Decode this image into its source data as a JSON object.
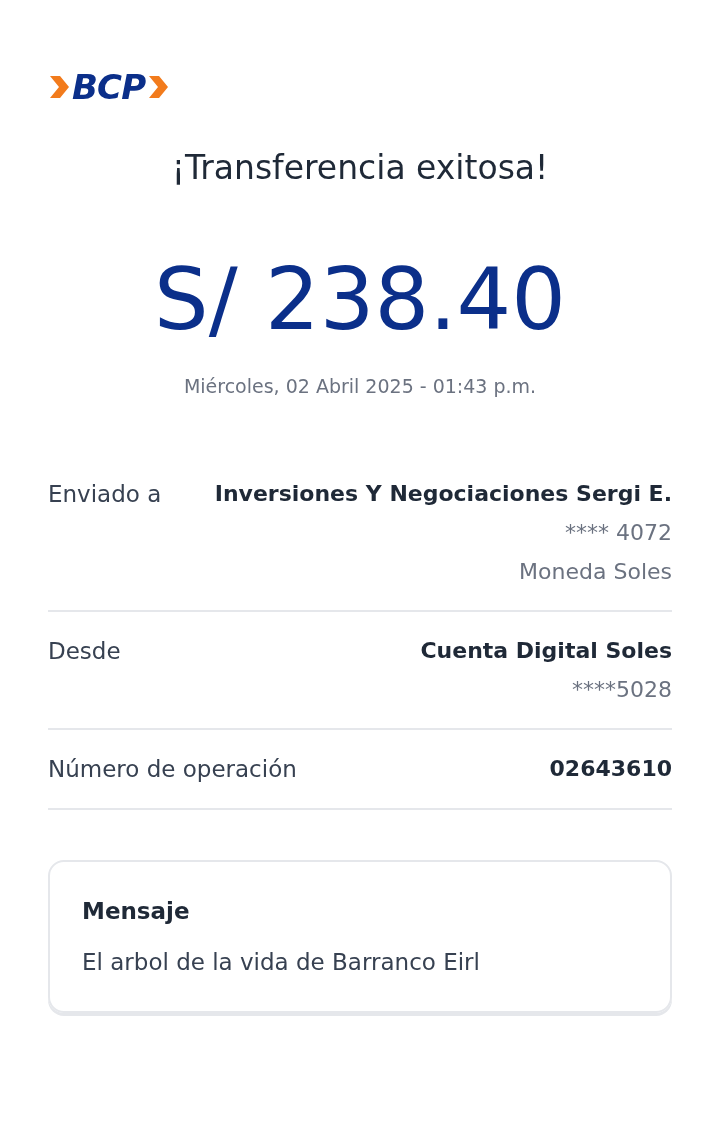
{
  "logo": "BCP",
  "title": "¡Transferencia exitosa!",
  "amount": "S/ 238.40",
  "datetime": "Miércoles, 02 Abril 2025 - 01:43 p.m.",
  "details": [
    {
      "label": "Enviado a",
      "lines": [
        {
          "text": "Inversiones Y Negociaciones Sergi E.",
          "bold": true
        },
        {
          "text": "**** 4072",
          "bold": false
        },
        {
          "text": "Moneda Soles",
          "bold": false
        }
      ]
    },
    {
      "label": "Desde",
      "lines": [
        {
          "text": "Cuenta Digital Soles",
          "bold": true
        },
        {
          "text": "****5028",
          "bold": false
        }
      ]
    },
    {
      "label": "Número de operación",
      "lines": [
        {
          "text": "02643610",
          "bold": true
        }
      ]
    }
  ],
  "message": {
    "title": "Mensaje",
    "text": "El arbol de la vida de Barranco Eirl"
  }
}
